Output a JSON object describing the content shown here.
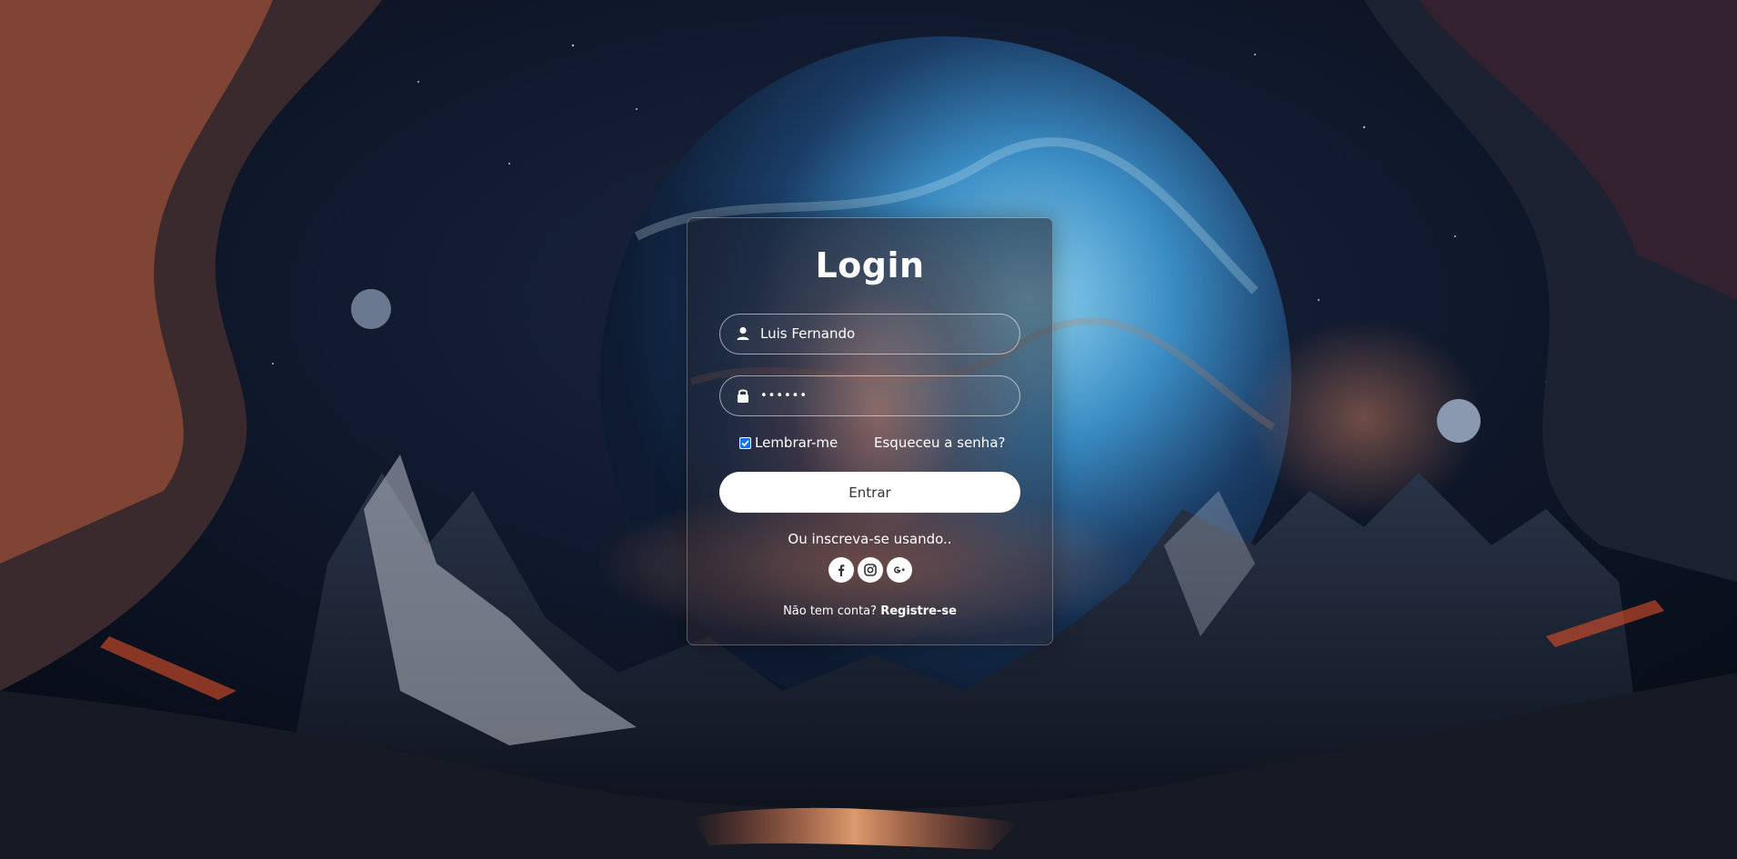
{
  "login": {
    "title": "Login",
    "username_value": "Luis Fernando",
    "password_value": "••••••",
    "remember_label": "Lembrar-me",
    "remember_checked": true,
    "forgot_label": "Esqueceu a senha?",
    "submit_label": "Entrar",
    "or_text": "Ou inscreva-se usando..",
    "socials": [
      {
        "icon": "facebook-icon"
      },
      {
        "icon": "instagram-icon"
      },
      {
        "icon": "google-plus-icon"
      }
    ],
    "no_account_text": "Não tem conta?",
    "register_label": "Registre-se"
  },
  "colors": {
    "accent_checkbox": "#1a73e8",
    "button_bg": "#ffffff",
    "button_text": "#333333",
    "card_border": "rgba(255,255,255,0.28)"
  }
}
